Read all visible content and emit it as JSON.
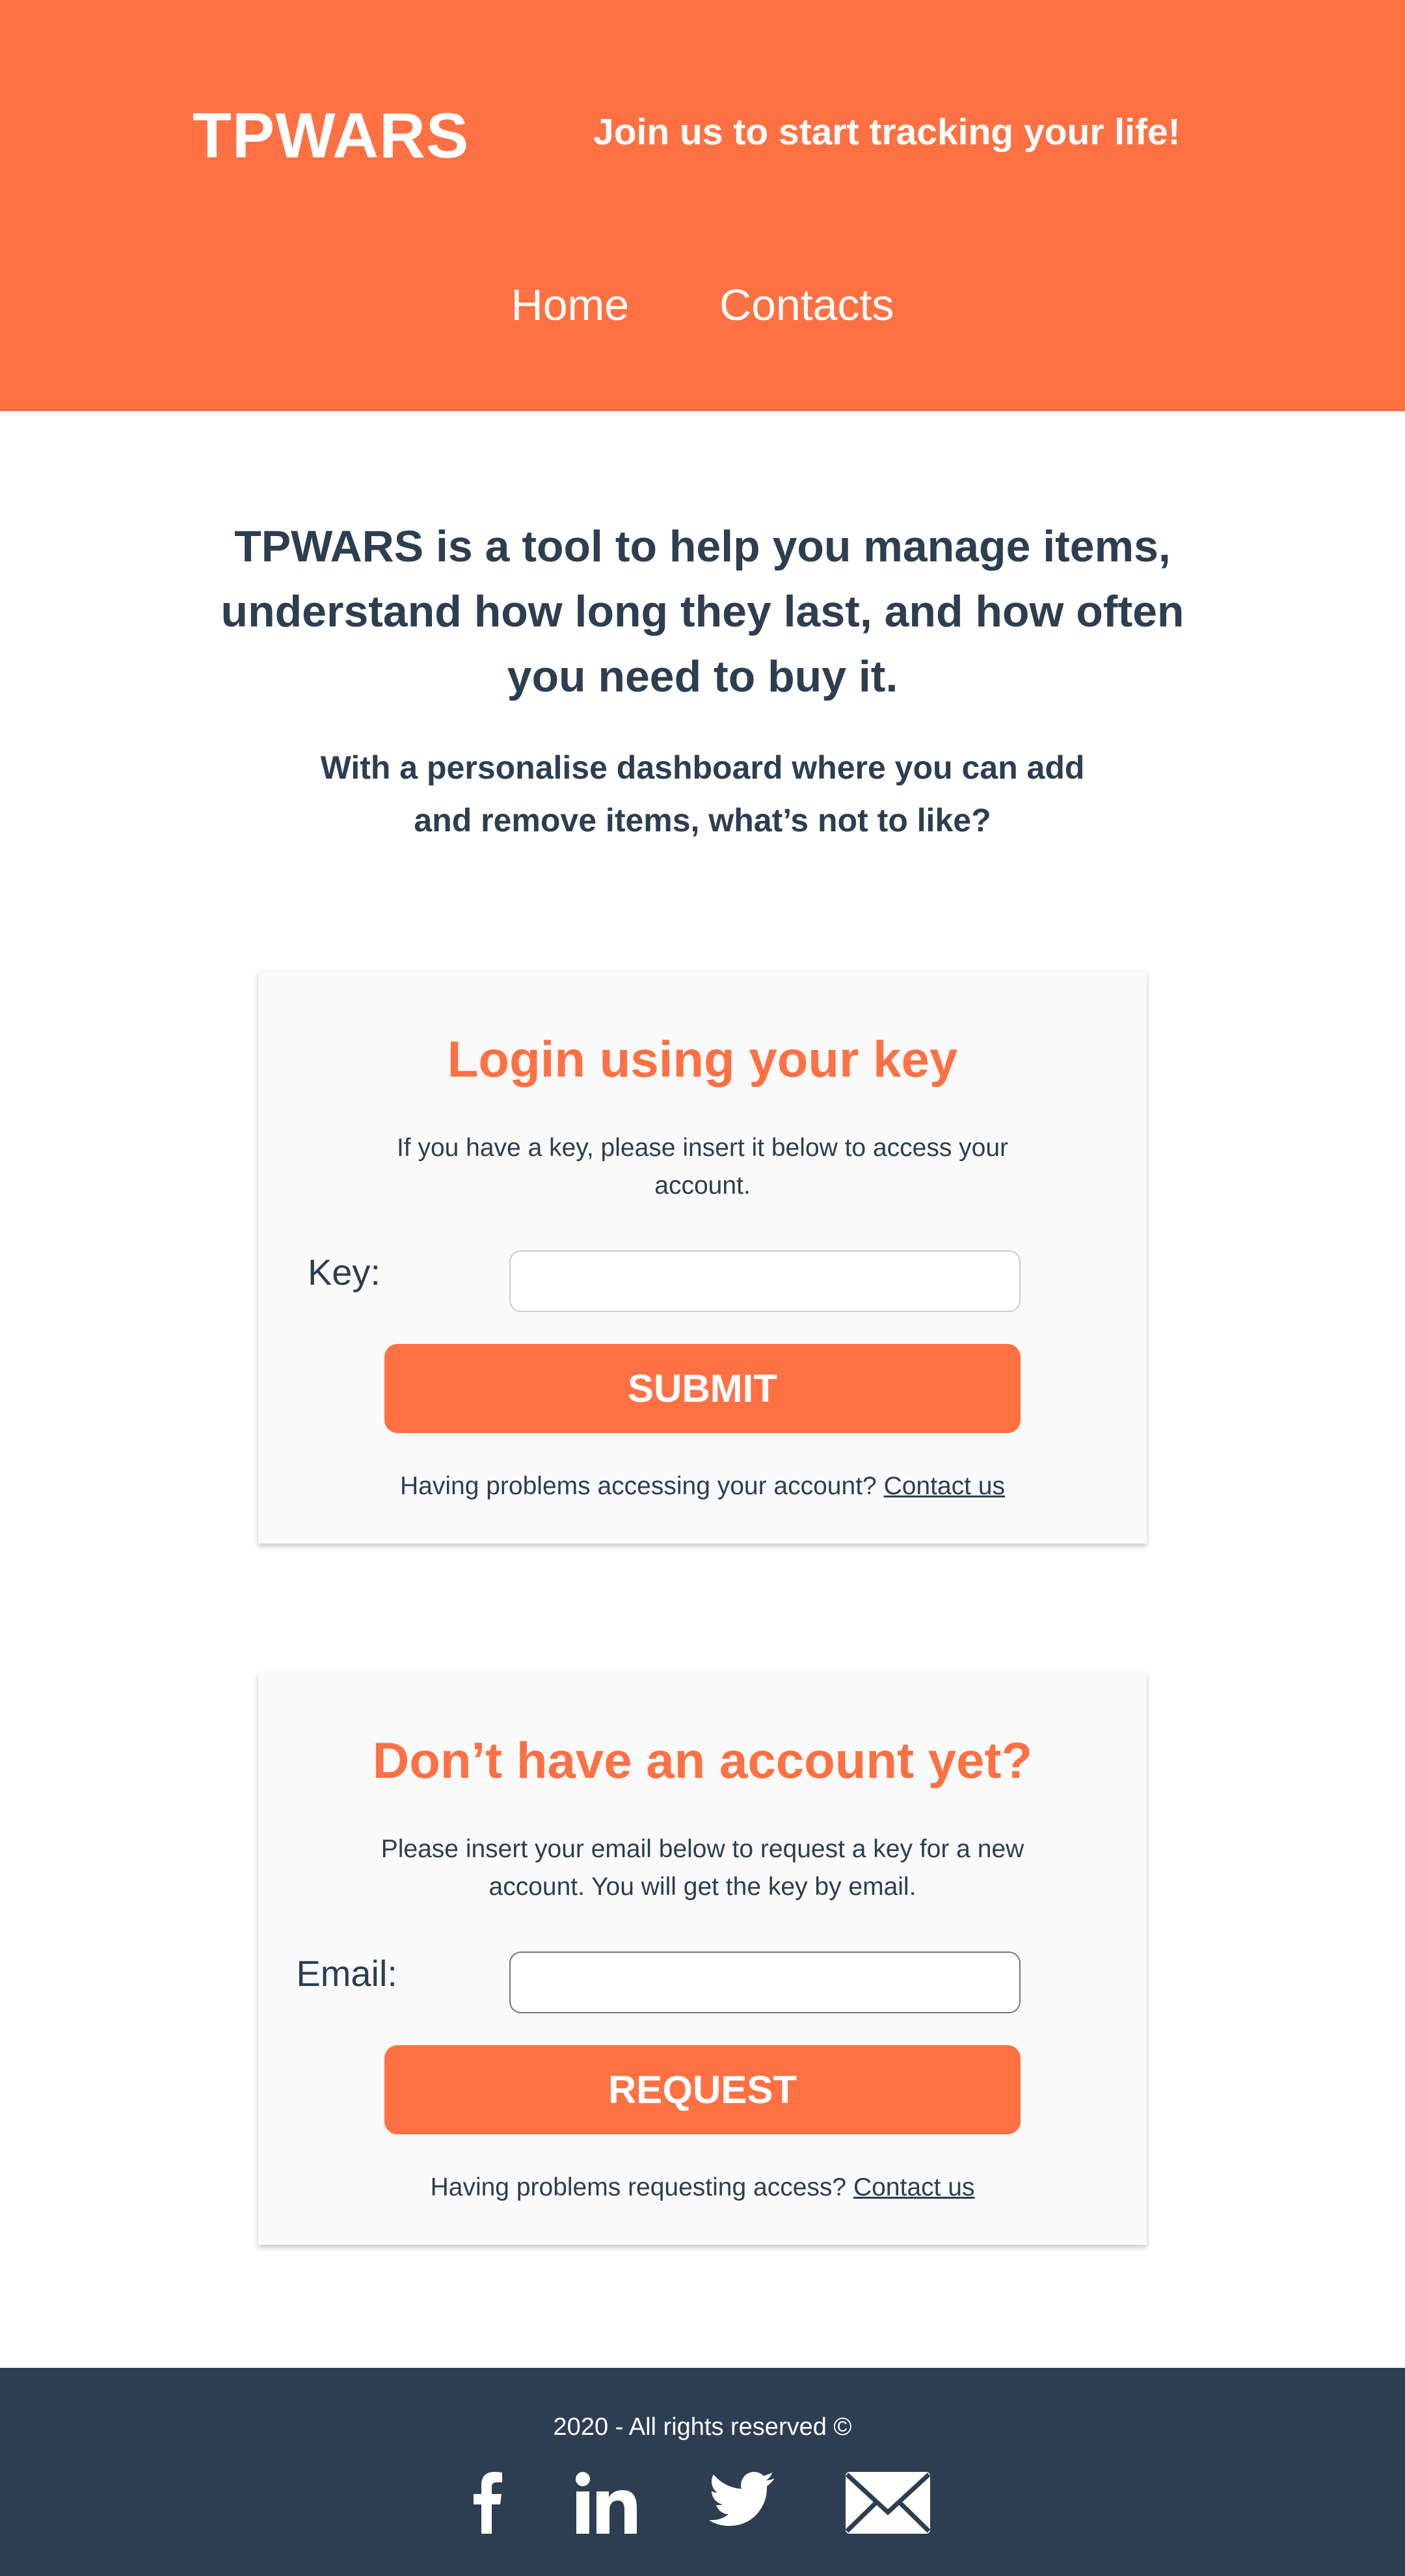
{
  "header": {
    "logo": "TPWARS",
    "tagline": "Join us to start tracking your life!",
    "nav": [
      "Home",
      "Contacts"
    ]
  },
  "intro": {
    "headline": "TPWARS is a tool to help you manage items, understand how long they last, and how often you need to buy it.",
    "subline": "With a personalise dashboard where you can add and remove items, what’s not to like?"
  },
  "login": {
    "title": "Login using your key",
    "description": "If you have a key, please insert it below to access your account.",
    "field_label": "Key:",
    "field_value": "",
    "button": "SUBMIT",
    "help_text": "Having problems accessing your account?",
    "help_link": "Contact us"
  },
  "request": {
    "title": "Don’t have an account yet?",
    "description": "Please insert your email below to request a key for a new account. You will get the key by email.",
    "field_label": "Email:",
    "field_value": "",
    "button": "REQUEST",
    "help_text": "Having problems requesting access?",
    "help_link": "Contact us"
  },
  "footer": {
    "copyright": "2020 - All rights reserved ©",
    "icons": [
      "facebook-icon",
      "linkedin-icon",
      "twitter-icon",
      "email-icon"
    ]
  },
  "colors": {
    "accent": "#ff7043",
    "text": "#2d3e50",
    "footer": "#2e3e52",
    "card": "#fafafa"
  }
}
